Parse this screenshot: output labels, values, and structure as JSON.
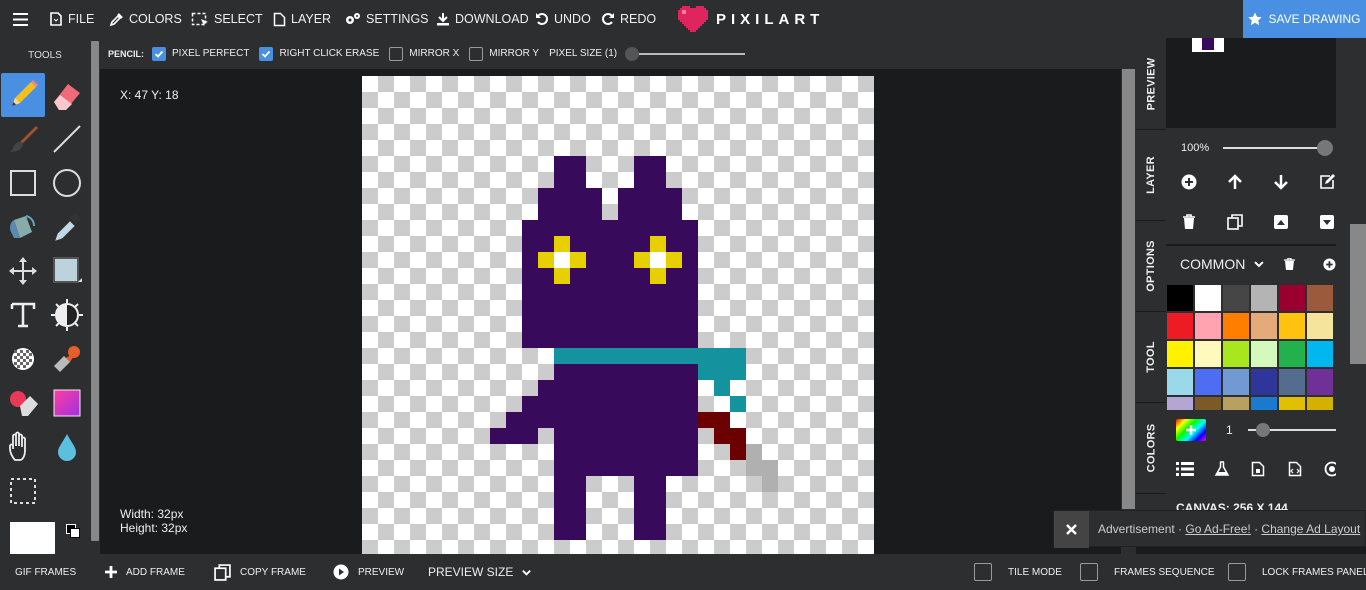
{
  "toolbar": {
    "file": "FILE",
    "colors": "COLORS",
    "select": "SELECT",
    "layer": "LAYER",
    "settings": "SETTINGS",
    "download": "DOWNLOAD",
    "undo": "UNDO",
    "redo": "REDO",
    "logo": "PIXILART",
    "save": "SAVE DRAWING"
  },
  "sidebar": {
    "title": "TOOLS",
    "tools": [
      "pencil-icon",
      "eraser-icon",
      "brush-icon",
      "line-icon",
      "rectangle-icon",
      "circle-icon",
      "fill-bucket-icon",
      "eyedropper-icon",
      "move-icon",
      "selection-shape-icon",
      "text-icon",
      "lighten-darken-icon",
      "dither-icon",
      "stamp-icon",
      "color-replace-icon",
      "gradient-icon",
      "pan-hand-icon",
      "blur-drop-icon",
      "marquee-select-icon"
    ],
    "active_tool": "pencil-icon",
    "primary_color": "#ffffff",
    "secondary_color": "#000000"
  },
  "options": {
    "tool_name": "PENCIL:",
    "pixel_perfect": {
      "label": "PIXEL PERFECT",
      "checked": true
    },
    "right_click_erase": {
      "label": "RIGHT CLICK ERASE",
      "checked": true
    },
    "mirror_x": {
      "label": "MIRROR X",
      "checked": false
    },
    "mirror_y": {
      "label": "MIRROR Y",
      "checked": false
    },
    "pixel_size": "PIXEL SIZE (1)"
  },
  "canvas": {
    "coords": "X: 47 Y: 18",
    "width": "Width: 32px",
    "height": "Height: 32px",
    "colors": {
      "purple": "#380a5c",
      "yellow": "#e8d000",
      "white": "#ffffff",
      "teal": "#14939e",
      "red": "#6b0000",
      "gray": "#b0b0b0"
    }
  },
  "right_panel": {
    "tabs": [
      "PREVIEW",
      "LAYER",
      "OPTIONS",
      "TOOL",
      "COLORS"
    ],
    "zoom": "100%",
    "palette_name": "COMMON",
    "palette": [
      "#000000",
      "#ffffff",
      "#464646",
      "#b4b4b4",
      "#990030",
      "#9c5a3c",
      "#ed1c24",
      "#ffa3b1",
      "#ff7e00",
      "#e5aa7a",
      "#ffc20e",
      "#f5e49c",
      "#fff200",
      "#fff9bd",
      "#a8e61d",
      "#d3f9bc",
      "#22b14c",
      "#00b7ef",
      "#99d9ea",
      "#4d6df3",
      "#709ad1",
      "#2f3699",
      "#546d8e",
      "#6f3198",
      "#b5a5d5",
      "#7c5a28",
      "#b8a060",
      "#1a7ad0",
      "#e0c000",
      "#d4b000"
    ],
    "brush_size": "1",
    "canvas_label": "CANVAS: 256 X 144"
  },
  "ad": {
    "text": "Advertisement · ",
    "go_ad_free": "Go Ad-Free!",
    "sep": " · ",
    "change_layout": "Change Ad Layout"
  },
  "bottom": {
    "gif_frames": "GIF FRAMES",
    "add_frame": "ADD FRAME",
    "copy_frame": "COPY FRAME",
    "preview": "PREVIEW",
    "preview_size": "PREVIEW SIZE",
    "tile_mode": "TILE MODE",
    "frames_sequence": "FRAMES SEQUENCE",
    "lock_frames": "LOCK FRAMES PANEL"
  }
}
